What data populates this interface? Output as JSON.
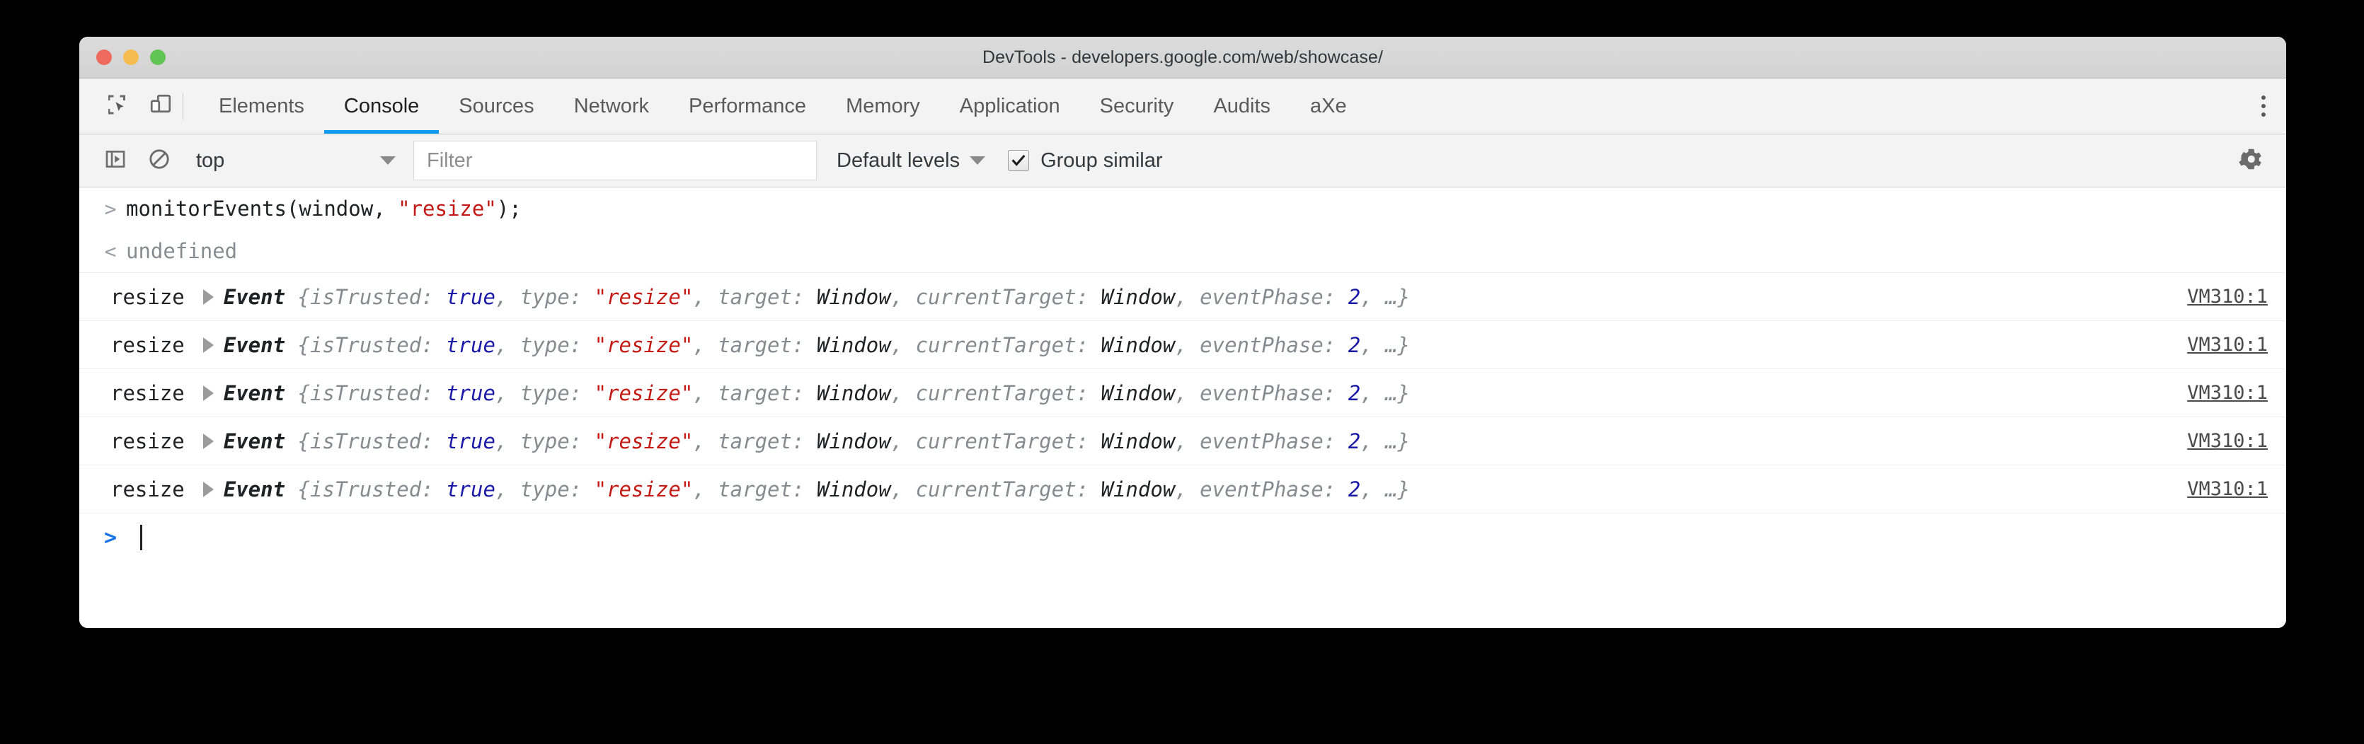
{
  "window": {
    "title": "DevTools - developers.google.com/web/showcase/",
    "traffic": {
      "close": "close-button",
      "minimize": "minimize-button",
      "zoom": "zoom-button"
    }
  },
  "toolbar_icons": {
    "inspect": "inspect-element-icon",
    "device": "device-toolbar-icon",
    "more": "more-tools-icon"
  },
  "tabs": [
    {
      "label": "Elements",
      "active": false
    },
    {
      "label": "Console",
      "active": true
    },
    {
      "label": "Sources",
      "active": false
    },
    {
      "label": "Network",
      "active": false
    },
    {
      "label": "Performance",
      "active": false
    },
    {
      "label": "Memory",
      "active": false
    },
    {
      "label": "Application",
      "active": false
    },
    {
      "label": "Security",
      "active": false
    },
    {
      "label": "Audits",
      "active": false
    },
    {
      "label": "aXe",
      "active": false
    }
  ],
  "console_toolbar": {
    "sidebar_icon": "console-sidebar-icon",
    "clear_icon": "clear-console-icon",
    "context": "top",
    "filter_placeholder": "Filter",
    "filter_value": "",
    "levels": "Default levels",
    "group_similar_label": "Group similar",
    "group_similar_checked": true,
    "settings_icon": "gear-icon"
  },
  "console": {
    "input_prompt": ">",
    "input_segments": [
      {
        "text": "monitorEvents(window, ",
        "kind": "plain"
      },
      {
        "text": "\"resize\"",
        "kind": "string"
      },
      {
        "text": ");",
        "kind": "plain"
      }
    ],
    "input_text": "monitorEvents(window, \"resize\");",
    "result_prompt": "<",
    "result_text": "undefined",
    "event_rows": [
      {
        "name": "resize",
        "ctor": "Event",
        "source": "VM310:1"
      },
      {
        "name": "resize",
        "ctor": "Event",
        "source": "VM310:1"
      },
      {
        "name": "resize",
        "ctor": "Event",
        "source": "VM310:1"
      },
      {
        "name": "resize",
        "ctor": "Event",
        "source": "VM310:1"
      },
      {
        "name": "resize",
        "ctor": "Event",
        "source": "VM310:1"
      }
    ],
    "event_detail": {
      "open_brace": "{",
      "isTrusted_key": "isTrusted: ",
      "isTrusted_val": "true",
      "type_key": ", type: ",
      "type_val": "\"resize\"",
      "target_key": ", target: ",
      "target_val": "Window",
      "currentTarget_key": ", currentTarget: ",
      "currentTarget_val": "Window",
      "eventPhase_key": ", eventPhase: ",
      "eventPhase_val": "2",
      "ellipsis": ", …}"
    },
    "prompt_symbol": ">"
  },
  "colors": {
    "accent": "#0e9bf0",
    "string": "#c41a16",
    "number": "#1a1aa6",
    "muted": "#868b90",
    "prompt": "#1a73e8"
  }
}
